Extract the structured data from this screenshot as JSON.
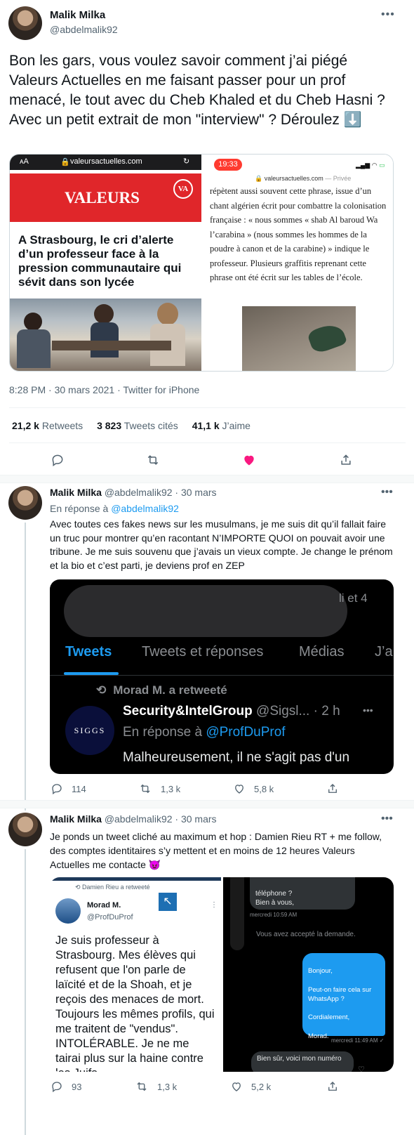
{
  "main_tweet": {
    "author_name": "Malik Milka",
    "handle": "@abdelmalik92",
    "text": "Bon les gars, vous voulez savoir comment j’ai piégé Valeurs Actuelles en me faisant passer pour un prof menacé, le tout avec du Cheb Khaled et du Cheb Hasni ? Avec un petit extrait de mon \"interview\" ? Déroulez ⬇️",
    "timestamp": "8:28 PM · 30 mars 2021 · Twitter for iPhone",
    "stats": {
      "retweets_value": "21,2 k",
      "retweets_label": "Retweets",
      "quotes_value": "3 823",
      "quotes_label": "Tweets cités",
      "likes_value": "41,1 k",
      "likes_label": "J’aime"
    },
    "media_left": {
      "aa": "ᴀA",
      "url": "valeursactuelles.com",
      "brand": "VALEURS",
      "badge": "VA",
      "headline": "A Strasbourg, le cri d’alerte d’un professeur face à la pression communautaire qui sévit dans son lycée"
    },
    "media_right": {
      "time": "19:33",
      "url": "valeursactuelles.com",
      "private": "— Privée",
      "body": "répètent aussi souvent cette phrase, issue d’un chant algérien écrit pour combattre la colonisation française : « nous sommes « shab Al baroud Wa l’carabina » (nous sommes les hommes de la poudre à canon et de la carabine) » indique le professeur. Plusieurs graffitis reprenant cette phrase ont été écrit sur les tables de l’école."
    }
  },
  "reply1": {
    "author_name": "Malik Milka",
    "handle": "@abdelmalik92",
    "date": "· 30 mars",
    "reply_to_label": "En réponse à",
    "reply_to_handle": "@abdelmalik92",
    "text": "Avec toutes ces fakes news sur les musulmans, je me suis dit qu’il fallait faire un truc pour montrer qu’en racontant N’IMPORTE QUOI on pouvait avoir une tribune. Je me suis souvenu que j’avais un vieux compte. Je change le prénom et la bio et c’est parti, je deviens prof en ZEP",
    "media": {
      "partial": "li et 4",
      "tabs": [
        "Tweets",
        "Tweets et réponses",
        "Médias",
        "J’a"
      ],
      "retweeted_by": "Morad M. a retweeté",
      "inner_name": "Security&IntelGroup",
      "inner_handle": "@Sigsl...",
      "inner_time": "· 2 h",
      "inner_reply_label": "En réponse à",
      "inner_reply_handle": "@ProfDuProf",
      "inner_text": "Malheureusement, il ne s'agit pas d'un",
      "logo_text": "SIGGS"
    },
    "actions": {
      "replies": "114",
      "retweets": "1,3 k",
      "likes": "5,8 k"
    }
  },
  "reply2": {
    "author_name": "Malik Milka",
    "handle": "@abdelmalik92",
    "date": "· 30 mars",
    "text": "Je ponds un tweet cliché au maximum et hop : Damien Rieu RT + me follow, des comptes identitaires s’y mettent et en moins de 12 heures Valeurs Actuelles me contacte 😈",
    "media_left": {
      "retweeted_by": "Damien Rieu a retweeté",
      "name": "Morad M.",
      "handle": "@ProfDuProf",
      "text": "Je suis professeur à Strasbourg. Mes élèves qui refusent que l'on parle de laïcité et de la Shoah, et je reçois des menaces de mort. Toujours les mêmes profils, qui me traitent de \"vendus\". INTOLÉRABLE. Je ne me tairai plus sur la haine contre les Juifs."
    },
    "media_right": {
      "msg_top": "téléphone ?\nBien à vous,",
      "time1": "mercredi 10:59 AM",
      "accepted": "Vous avez accepté la demande.",
      "msg_blue": "Bonjour,\n\nPeut-on faire cela sur WhatsApp ?\n\nCordialement,\n\nMorad.",
      "time2": "mercredi 11:49 AM ✓",
      "msg_bottom": "Bien sûr, voici mon numéro"
    },
    "actions": {
      "replies": "93",
      "retweets": "1,3 k",
      "likes": "5,2 k"
    }
  },
  "colors": {
    "accent": "#1d9bf0",
    "like": "#f91880",
    "va_red": "#e0262a",
    "dm_blue": "#1d9bf0"
  }
}
